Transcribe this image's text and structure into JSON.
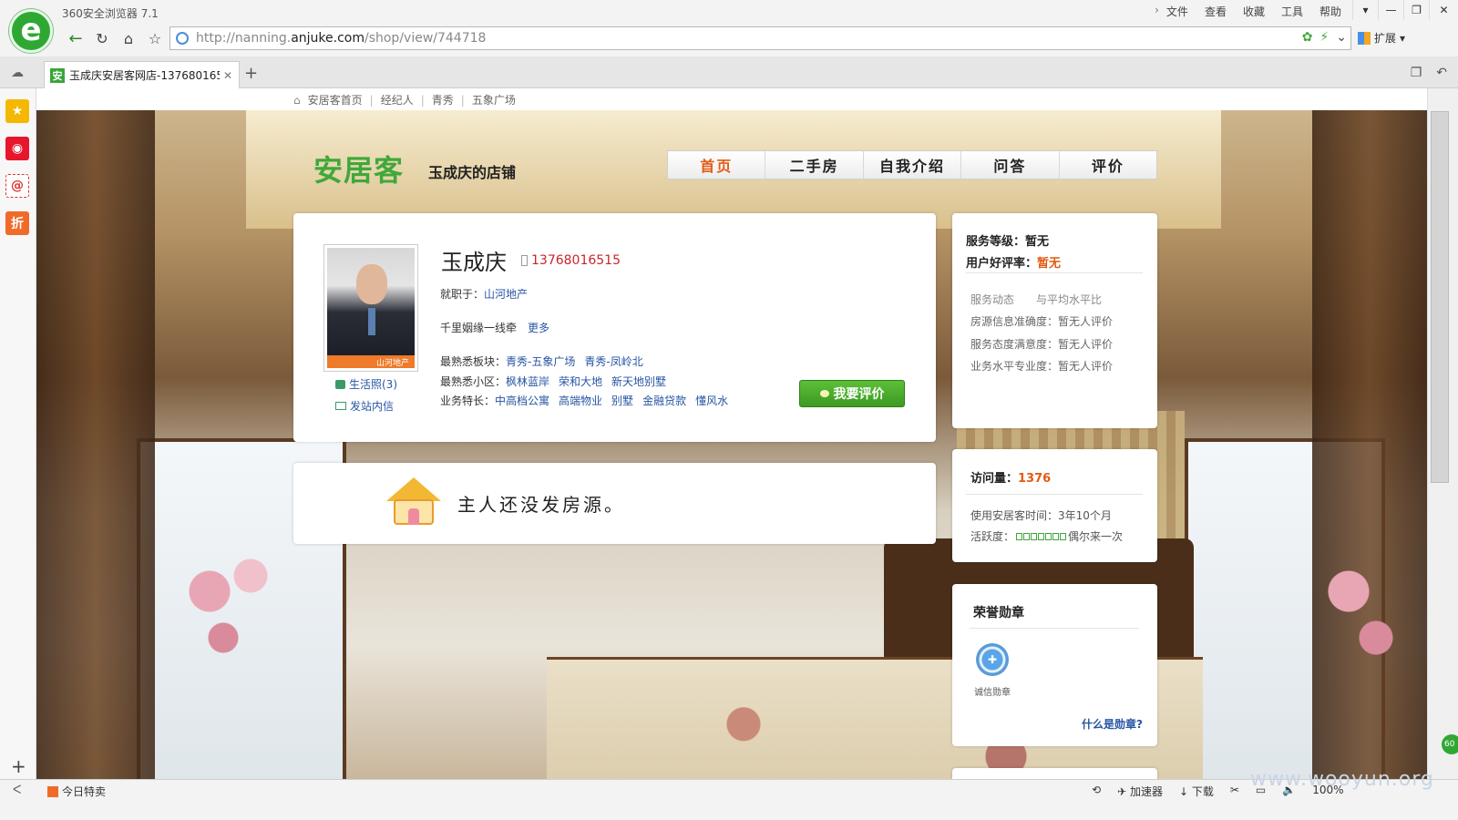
{
  "browser": {
    "title": "360安全浏览器 7.1",
    "menu": [
      "文件",
      "查看",
      "收藏",
      "工具",
      "帮助"
    ],
    "url_prefix": "http://nanning.",
    "url_domain": "anjuke.com",
    "url_path": "/shop/view/744718",
    "extensions_label": "扩展",
    "tab_title": "玉成庆安居客网店-137680165",
    "favicon_text": "安",
    "logo_text": "e"
  },
  "sidebar": {
    "discount_text": "折",
    "mail_text": "@"
  },
  "statusbar": {
    "today_deal": "今日特卖",
    "accelerator": "加速器",
    "download": "下载",
    "zoom": "100%",
    "watermark": "www.wooyun.org",
    "scroll_badge": "60"
  },
  "breadcrumb": [
    "安居客首页",
    "经纪人",
    "青秀",
    "五象广场"
  ],
  "header": {
    "logo": "安居客",
    "shop_name": "玉成庆的店铺",
    "nav": [
      "首页",
      "二手房",
      "自我介绍",
      "问答",
      "评价"
    ]
  },
  "profile": {
    "name": "玉成庆",
    "phone": "13768016515",
    "company_label": "就职于：",
    "company": "山河地产",
    "agency_strip": "山河地产",
    "slogan": "千里姻缘一线牵",
    "more": "更多",
    "area_label": "最熟悉板块：",
    "areas": [
      "青秀-五象广场",
      "青秀-凤岭北"
    ],
    "community_label": "最熟悉小区：",
    "communities": [
      "枫林蓝岸",
      "荣和大地",
      "新天地别墅"
    ],
    "specialty_label": "业务特长：",
    "specialties": [
      "中高档公寓",
      "高端物业",
      "别墅",
      "金融贷款",
      "懂风水"
    ],
    "life_photos": "生活照(3)",
    "send_message": "发站内信",
    "review_button": "我要评价"
  },
  "empty_listing": {
    "text": "主人还没发房源。"
  },
  "service": {
    "level_label": "服务等级：",
    "level": "暂无",
    "rating_label": "用户好评率：",
    "rating": "暂无",
    "tabs": [
      "服务动态",
      "与平均水平比"
    ],
    "rows": [
      "房源信息准确度：暂无人评价",
      "服务态度满意度：暂无人评价",
      "业务水平专业度：暂无人评价"
    ]
  },
  "stats": {
    "visits_label": "访问量：",
    "visits": "1376",
    "usage_time": "使用安居客时间：3年10个月",
    "activity_label": "活跃度：",
    "activity_text": "偶尔来一次",
    "activity_level": 0
  },
  "honor": {
    "title": "荣誉勋章",
    "badge": "诚信勋章",
    "what_is": "什么是勋章?"
  }
}
